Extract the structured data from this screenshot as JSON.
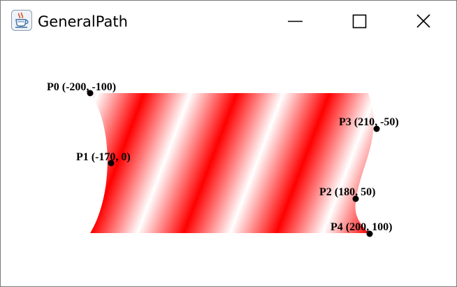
{
  "window": {
    "title": "GeneralPath",
    "app_icon": "java-coffee-cup-icon",
    "controls": {
      "minimize_icon": "minimize-icon",
      "maximize_icon": "maximize-icon",
      "close_icon": "close-icon"
    }
  },
  "colors": {
    "gradient_primary": "#ff0000",
    "gradient_secondary": "#ffffff",
    "point_color": "#000000",
    "label_color": "#000000"
  },
  "points": [
    {
      "id": "P0",
      "label": "P0 (-200, -100)"
    },
    {
      "id": "P1",
      "label": "P1 (-170, 0)"
    },
    {
      "id": "P2",
      "label": "P2 (180, 50)"
    },
    {
      "id": "P3",
      "label": "P3 (210, -50)"
    },
    {
      "id": "P4",
      "label": "P4 (200, 100)"
    }
  ]
}
